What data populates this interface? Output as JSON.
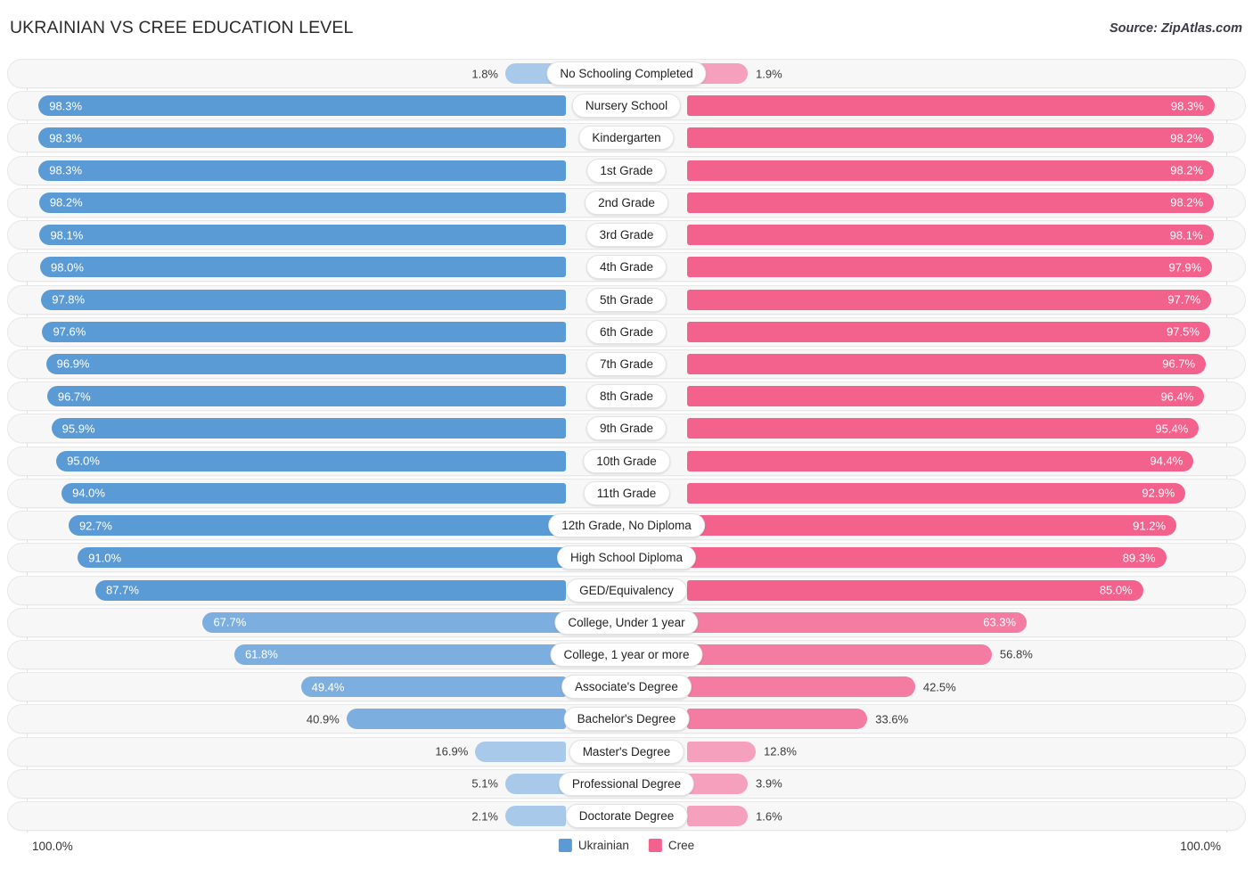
{
  "header": {
    "title": "UKRAINIAN VS CREE EDUCATION LEVEL",
    "source": "Source: ZipAtlas.com"
  },
  "footer": {
    "axis_left": "100.0%",
    "axis_right": "100.0%",
    "legend": [
      {
        "label": "Ukrainian",
        "color": "#5b9bd5"
      },
      {
        "label": "Cree",
        "color": "#f2628c"
      }
    ]
  },
  "colors": {
    "ukrainian_strong": "#5b9bd5",
    "ukrainian_mid": "#7cafe0",
    "ukrainian_light": "#a8c9ea",
    "cree_strong": "#f2628c",
    "cree_mid": "#f47ba2",
    "cree_light": "#f5a0bc",
    "track": "#f7f7f7",
    "track_border": "#e8e8e8"
  },
  "chart_data": {
    "type": "bar",
    "subtype": "diverging-paired-bar",
    "title": "UKRAINIAN VS CREE EDUCATION LEVEL",
    "xlabel": "",
    "ylabel": "",
    "xlim": [
      0,
      100
    ],
    "grid": false,
    "legend_position": "bottom-center",
    "axis_tick_labels": [
      "100.0%",
      "100.0%"
    ],
    "categories": [
      "No Schooling Completed",
      "Nursery School",
      "Kindergarten",
      "1st Grade",
      "2nd Grade",
      "3rd Grade",
      "4th Grade",
      "5th Grade",
      "6th Grade",
      "7th Grade",
      "8th Grade",
      "9th Grade",
      "10th Grade",
      "11th Grade",
      "12th Grade, No Diploma",
      "High School Diploma",
      "GED/Equivalency",
      "College, Under 1 year",
      "College, 1 year or more",
      "Associate's Degree",
      "Bachelor's Degree",
      "Master's Degree",
      "Professional Degree",
      "Doctorate Degree"
    ],
    "series": [
      {
        "name": "Ukrainian",
        "color": "#5b9bd5",
        "values": [
          1.8,
          98.3,
          98.3,
          98.3,
          98.2,
          98.1,
          98.0,
          97.8,
          97.6,
          96.9,
          96.7,
          95.9,
          95.0,
          94.0,
          92.7,
          91.0,
          87.7,
          67.7,
          61.8,
          49.4,
          40.9,
          16.9,
          5.1,
          2.1
        ],
        "labels": [
          "1.8%",
          "98.3%",
          "98.3%",
          "98.3%",
          "98.2%",
          "98.1%",
          "98.0%",
          "97.8%",
          "97.6%",
          "96.9%",
          "96.7%",
          "95.9%",
          "95.0%",
          "94.0%",
          "92.7%",
          "91.0%",
          "87.7%",
          "67.7%",
          "61.8%",
          "49.4%",
          "40.9%",
          "16.9%",
          "5.1%",
          "2.1%"
        ]
      },
      {
        "name": "Cree",
        "color": "#f2628c",
        "values": [
          1.9,
          98.3,
          98.2,
          98.2,
          98.2,
          98.1,
          97.9,
          97.7,
          97.5,
          96.7,
          96.4,
          95.4,
          94.4,
          92.9,
          91.2,
          89.3,
          85.0,
          63.3,
          56.8,
          42.5,
          33.6,
          12.8,
          3.9,
          1.6
        ],
        "labels": [
          "1.9%",
          "98.3%",
          "98.2%",
          "98.2%",
          "98.2%",
          "98.1%",
          "97.9%",
          "97.7%",
          "97.5%",
          "96.7%",
          "96.4%",
          "95.4%",
          "94.4%",
          "92.9%",
          "91.2%",
          "89.3%",
          "85.0%",
          "63.3%",
          "56.8%",
          "42.5%",
          "33.6%",
          "12.8%",
          "3.9%",
          "1.6%"
        ]
      }
    ]
  }
}
